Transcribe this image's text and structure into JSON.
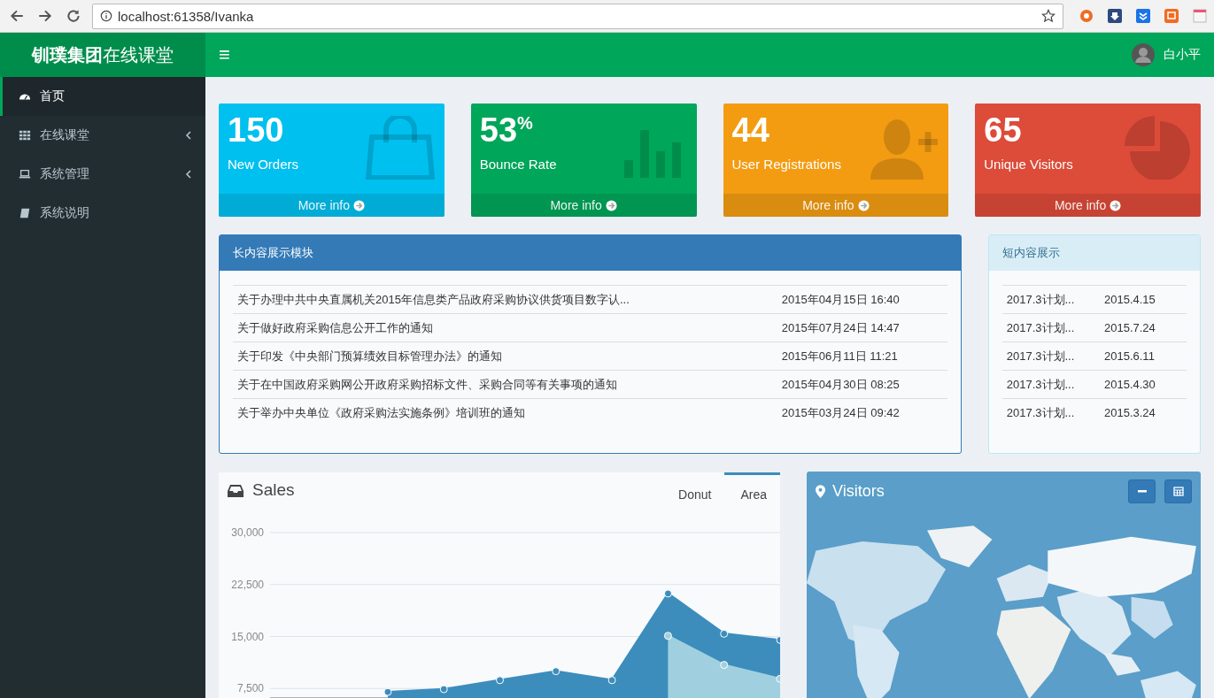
{
  "browser": {
    "url": "localhost:61358/Ivanka"
  },
  "header": {
    "brand": "**钏璞集团**在线课堂",
    "menu_glyph": "≡",
    "user": "白小平"
  },
  "sidebar": {
    "items": [
      {
        "label": "首页",
        "kind": "link",
        "selected": true
      },
      {
        "label": "在线课堂",
        "kind": "menu",
        "selected": false
      },
      {
        "label": "系统管理",
        "kind": "menu",
        "selected": false
      },
      {
        "label": "系统说明",
        "kind": "link",
        "selected": false
      }
    ]
  },
  "stats": [
    {
      "value": "150",
      "label": "New Orders",
      "footer": "More info",
      "color": "#00c0ef",
      "kind": "bag"
    },
    {
      "value": "53",
      "suffix": "%",
      "label": "Bounce Rate",
      "footer": "More info",
      "color": "#00a65a",
      "kind": "bars"
    },
    {
      "value": "44",
      "label": "User Registrations",
      "footer": "More info",
      "color": "#f39c12",
      "kind": "user"
    },
    {
      "value": "65",
      "label": "Unique Visitors",
      "footer": "More info",
      "color": "#dd4b39",
      "kind": "pie"
    }
  ],
  "long_panel": {
    "title": "长内容展示模块",
    "rows": [
      {
        "title": "关于办理中共中央直属机关2015年信息类产品政府采购协议供货项目数字认...",
        "date": "2015年04月15日 16:40"
      },
      {
        "title": "关于做好政府采购信息公开工作的通知",
        "date": "2015年07月24日 14:47"
      },
      {
        "title": "关于印发《中央部门预算绩效目标管理办法》的通知",
        "date": "2015年06月11日 11:21"
      },
      {
        "title": "关于在中国政府采购网公开政府采购招标文件、采购合同等有关事项的通知",
        "date": "2015年04月30日 08:25"
      },
      {
        "title": "关于举办中央单位《政府采购法实施条例》培训班的通知",
        "date": "2015年03月24日 09:42"
      }
    ]
  },
  "short_panel": {
    "title": "短内容展示",
    "rows": [
      {
        "title": "2017.3计划...",
        "date": "2015.4.15"
      },
      {
        "title": "2017.3计划...",
        "date": "2015.7.24"
      },
      {
        "title": "2017.3计划...",
        "date": "2015.6.11"
      },
      {
        "title": "2017.3计划...",
        "date": "2015.4.30"
      },
      {
        "title": "2017.3计划...",
        "date": "2015.3.24"
      }
    ]
  },
  "sales": {
    "title": "Sales",
    "tabs": [
      {
        "label": "Donut",
        "selected": false
      },
      {
        "label": "Area",
        "selected": true
      }
    ],
    "chart_data": {
      "type": "area",
      "stacked": false,
      "grid": true,
      "categories": [
        null,
        null,
        null,
        null,
        null,
        null,
        null,
        null
      ],
      "ylim": [
        6000,
        30000
      ],
      "yticks": [
        {
          "value": 30000,
          "label": "30,000"
        },
        {
          "value": 22500,
          "label": "22,500"
        },
        {
          "value": 15000,
          "label": "15,000"
        },
        {
          "value": 7500,
          "label": "7,500"
        }
      ],
      "series": [
        {
          "color": "#3c8dbc",
          "values": [
            7000,
            7400,
            8700,
            10000,
            8700,
            21200,
            15400,
            14500
          ]
        },
        {
          "color": "#a0d0e0",
          "values": [
            null,
            null,
            null,
            null,
            null,
            15100,
            10900,
            8900
          ]
        }
      ]
    }
  },
  "visitors": {
    "title": "Visitors",
    "kind": "picture"
  }
}
